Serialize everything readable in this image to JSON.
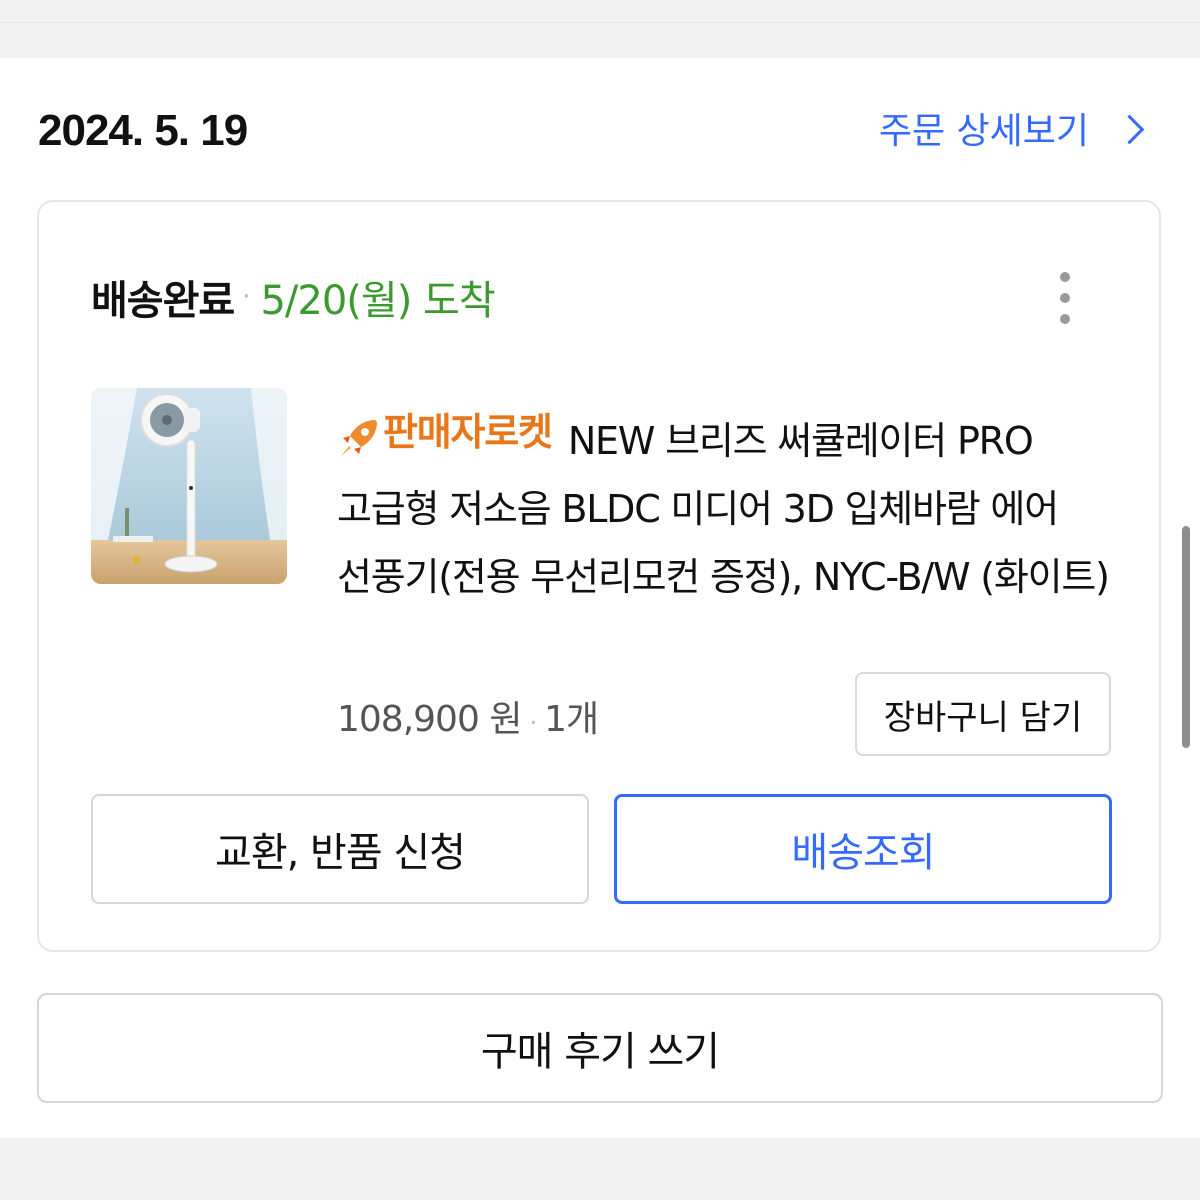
{
  "order": {
    "date": "2024. 5. 19",
    "detail_link_label": "주문 상세보기"
  },
  "shipment": {
    "status": "배송완료",
    "separator": "·",
    "arrival": "5/20(월) 도착"
  },
  "product": {
    "badge_label": "판매자로켓",
    "title": "NEW 브리즈 써큘레이터 PRO 고급형 저소음 BLDC 미디어 3D 입체바람 에어 선풍기(전용 무선리모컨 증정), NYC-B/W (화이트)",
    "price": "108,900 원",
    "separator": "·",
    "quantity": "1개",
    "thumbnail_icon": "fan-product-image"
  },
  "buttons": {
    "add_to_cart": "장바구니 담기",
    "exchange_return": "교환, 반품 신청",
    "track_delivery": "배송조회",
    "write_review": "구매 후기 쓰기"
  },
  "colors": {
    "accent_blue": "#346aff",
    "delivered_green": "#3a9a2f",
    "rocket_orange": "#e8771a"
  }
}
